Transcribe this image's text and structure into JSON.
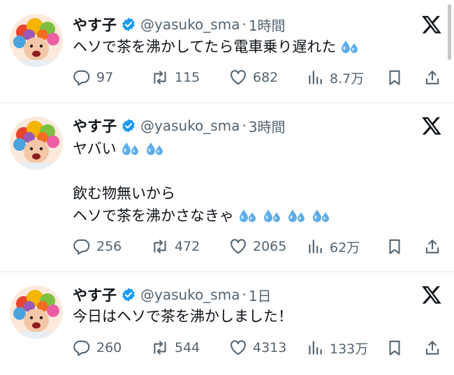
{
  "colors": {
    "text": "#0f1419",
    "secondary": "#536471",
    "verified": "#1d9bf0",
    "divider": "#eff3f4"
  },
  "tweets": [
    {
      "name": "やす子",
      "handle": "@yasuko_sma",
      "separator": "·",
      "time": "1時間",
      "lines": [
        "ヘソで茶を沸かしてたら電車乗り遅れた"
      ],
      "emoji": "sweat-droplets-icon",
      "stats": {
        "replies": "97",
        "reposts": "115",
        "likes": "682",
        "views": "8.7万"
      }
    },
    {
      "name": "やす子",
      "handle": "@yasuko_sma",
      "separator": "·",
      "time": "3時間",
      "lines": [
        "ヤバい",
        "",
        "飲む物無いから",
        "ヘソで茶を沸かさなきゃ"
      ],
      "emoji": "sweat-droplets-icon",
      "stats": {
        "replies": "256",
        "reposts": "472",
        "likes": "2065",
        "views": "62万"
      }
    },
    {
      "name": "やす子",
      "handle": "@yasuko_sma",
      "separator": "·",
      "time": "1日",
      "lines": [
        "今日はヘソで茶を沸かしました！"
      ],
      "stats": {
        "replies": "260",
        "reposts": "544",
        "likes": "4313",
        "views": "133万"
      }
    }
  ]
}
